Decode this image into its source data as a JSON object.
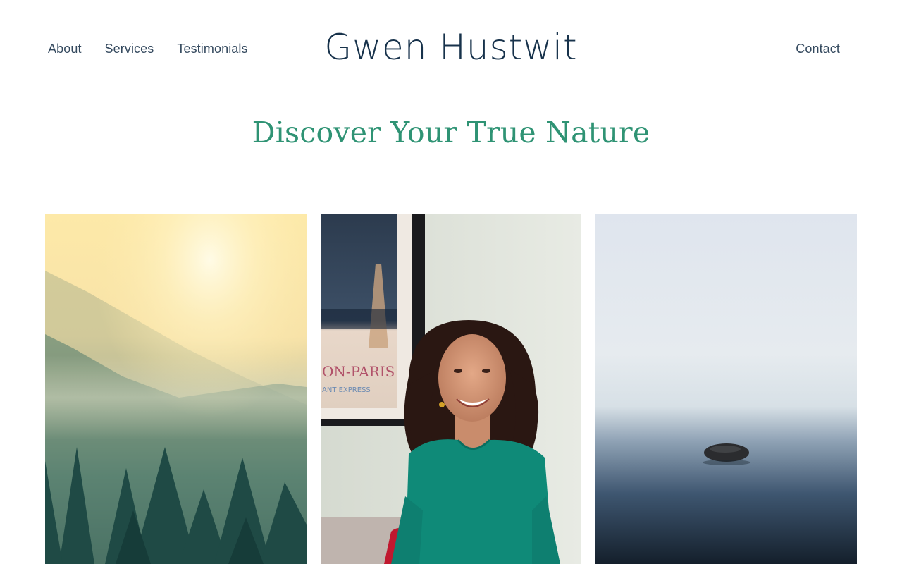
{
  "header": {
    "nav_left": [
      "About",
      "Services",
      "Testimonials"
    ],
    "logo_text": "Gwen Hustwit",
    "nav_right": "Contact"
  },
  "hero": {
    "title": "Discover Your True Nature"
  },
  "gallery": {
    "poster_text": "ON-PARIS",
    "poster_subtext": "ANT EXPRESS"
  },
  "colors": {
    "accent": "#2f9374",
    "nav_text": "#34495e",
    "logo": "#17324b"
  }
}
